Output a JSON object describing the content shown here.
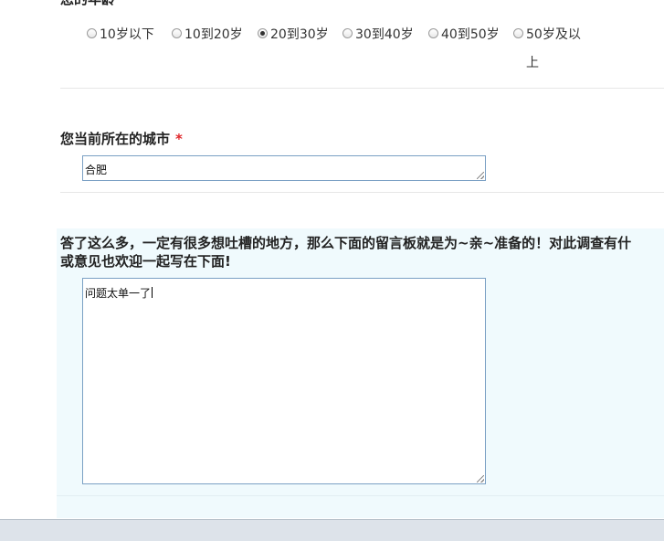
{
  "age_question": {
    "label": "您的年龄",
    "required_mark": "*",
    "options": [
      {
        "label": "10岁以下",
        "checked": false
      },
      {
        "label": "10到20岁",
        "checked": false
      },
      {
        "label": "20到30岁",
        "checked": true
      },
      {
        "label": "30到40岁",
        "checked": false
      },
      {
        "label": "40到50岁",
        "checked": false
      },
      {
        "label": "50岁及以上",
        "checked": false
      }
    ]
  },
  "city_question": {
    "label": "您当前所在的城市",
    "required_mark": "*",
    "value": "合肥"
  },
  "comment_question": {
    "label_line1": "答了这么多，一定有很多想吐槽的地方，那么下面的留言板就是为~亲~准备的！对此调查有什",
    "label_line2": "或意见也欢迎一起写在下面!",
    "value": "问题太单一了"
  },
  "colors": {
    "required": "#e0262a",
    "comment_bg": "#f0fafd",
    "input_border": "#7aa0c4"
  }
}
